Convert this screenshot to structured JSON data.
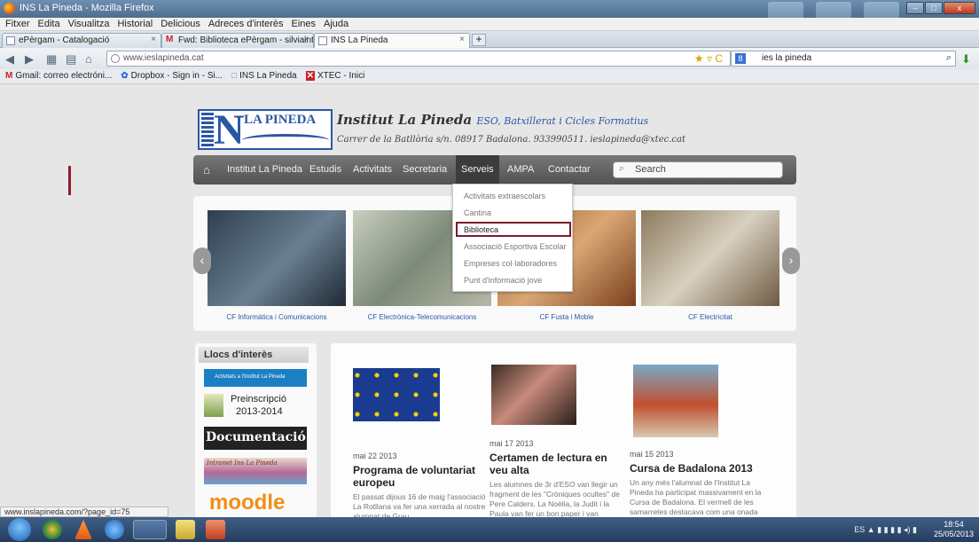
{
  "window": {
    "title": "INS La Pineda - Mozilla Firefox",
    "controls": [
      "–",
      "□",
      "x"
    ]
  },
  "menubar": [
    "Fitxer",
    "Edita",
    "Visualitza",
    "Historial",
    "Delicious",
    "Adreces d'interès",
    "Eines",
    "Ajuda"
  ],
  "tabs": [
    {
      "label": "ePèrgam - Catalogació",
      "active": false
    },
    {
      "label": "Fwd: Biblioteca ePèrgam - silviainthe...",
      "active": false
    },
    {
      "label": "INS La Pineda",
      "active": true
    }
  ],
  "navbar": {
    "url": "www.ieslapineda.cat",
    "search_engine": "ies la pineda"
  },
  "bookmarks": [
    {
      "icon": "M",
      "label": "Gmail: correo electróni..."
    },
    {
      "icon": "✿",
      "label": "Dropbox - Sign in - Si..."
    },
    {
      "icon": "□",
      "label": "INS La Pineda"
    },
    {
      "icon": "✕",
      "label": "XTEC - Inici"
    }
  ],
  "site": {
    "logo_text": "LA PINEDA",
    "name": "Institut La Pineda",
    "name_sub": "ESO, Batxillerat i Cicles Formatius",
    "address": "Carrer de la Batllòria s/n. 08917 Badalona. 933990511. ieslapineda@xtec.cat"
  },
  "mainnav": [
    "Institut La Pineda",
    "Estudis",
    "Activitats",
    "Secretaria",
    "Serveis",
    "AMPA",
    "Contactar"
  ],
  "mainnav_active": "Serveis",
  "site_search_placeholder": "Search",
  "dropdown": [
    "Activitats extraescolars",
    "Cantina",
    "Biblioteca",
    "Associació Esportiva Escolar",
    "Empreses col·laboradores",
    "Punt d'informació jove"
  ],
  "dropdown_highlight": "Biblioteca",
  "carousel": [
    "CF Informàtica i Comunicacions",
    "CF Electrònica-Telecomunicacions",
    "CF Fusta i Moble",
    "CF Electricitat"
  ],
  "llocs": {
    "heading": "Llocs d'interès",
    "banner1": "Activitats a l'Institut La Pineda",
    "preinscripcio": "Preinscripció",
    "preinscripcio_years": "2013-2014",
    "documentacio": "Documentació",
    "intranet": "Intranet Ins La Pineda",
    "moodle": "moodle"
  },
  "news": [
    {
      "date": "mai 22 2013",
      "title": "Programa de voluntariat europeu",
      "body": "El passat dijous 16 de maig l'associació La Rotllana va fer una xerrada al nostre alumnat de Grau"
    },
    {
      "date": "mai 17 2013",
      "title": "Certamen de lectura en veu alta",
      "body": "Les alumnes de 3r d'ESO van llegir un fragment de les \"Cròniques ocultes\" de Pere Calders. La Noèlia, la Judit i la Paula van fer un bon paper i van"
    },
    {
      "date": "mai 15 2013",
      "title": "Cursa de Badalona 2013",
      "body": "Un any més l'alumnat de l'Institut La Pineda ha participat massivament en la Cursa de Badalona. El vermell de les samarretes destacava com una onada"
    }
  ],
  "statusbar": "www.inslapineda.com/?page_id=75",
  "taskbar": {
    "lang": "ES",
    "time": "18:54",
    "date": "25/05/2013"
  }
}
